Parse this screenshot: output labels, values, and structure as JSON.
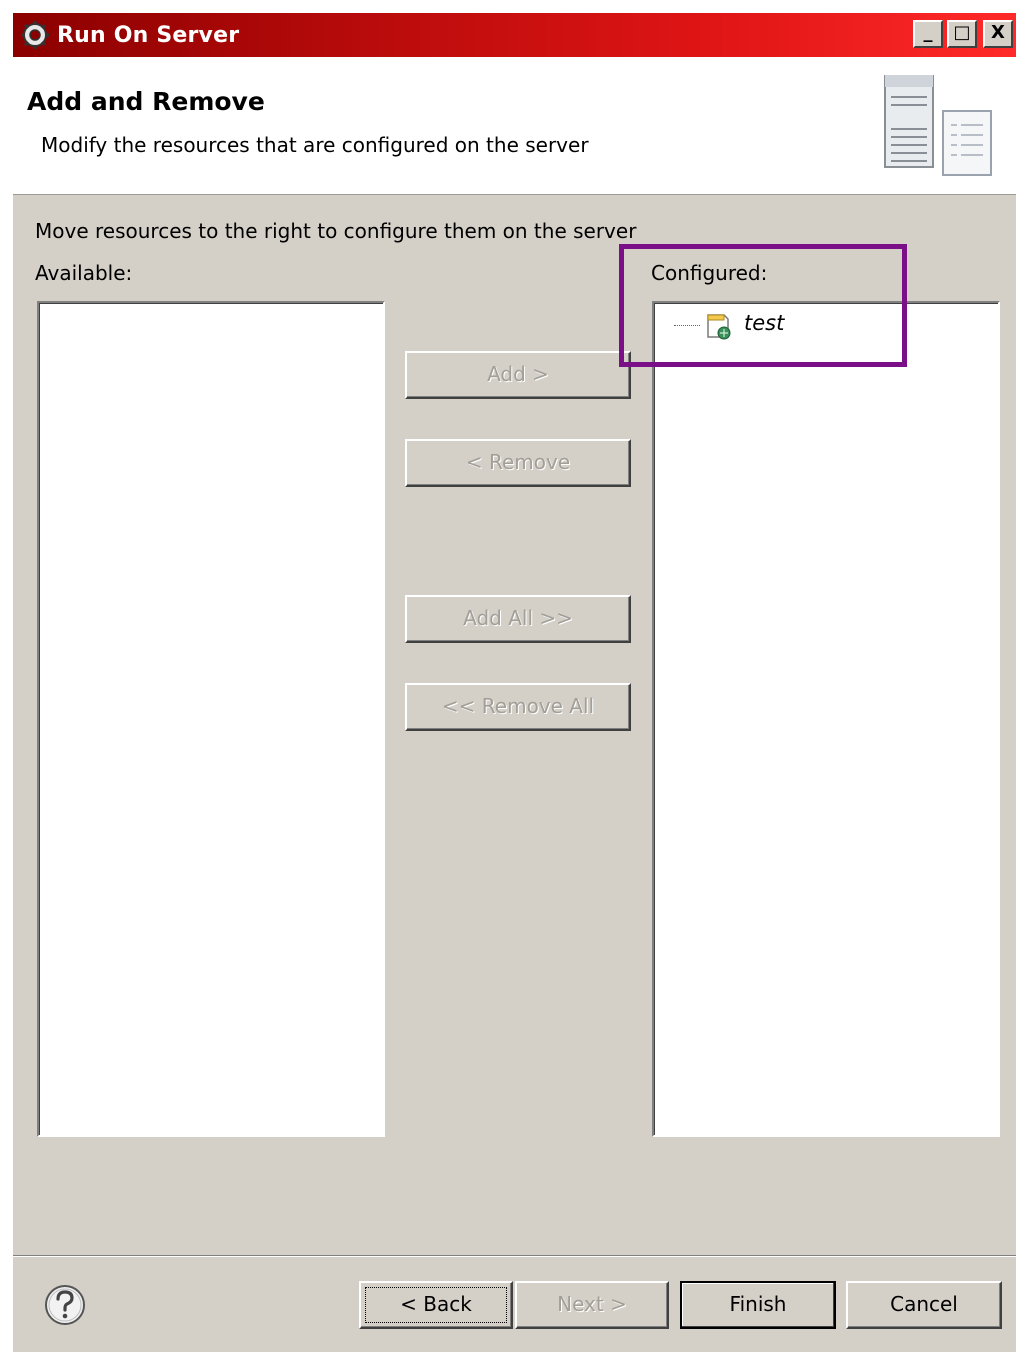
{
  "window": {
    "title": "Run On Server",
    "controls": {
      "minimize": "_",
      "maximize": "□",
      "close": "X"
    }
  },
  "banner": {
    "title": "Add and Remove",
    "description": "Modify the resources that are configured on the server",
    "graphic": "server-banner-icon"
  },
  "content": {
    "instruction": "Move resources to the right to configure them on the server",
    "available_label": "Available:",
    "configured_label": "Configured:",
    "configured_items": [
      {
        "label": "test",
        "icon": "web-project-icon"
      }
    ]
  },
  "transfer_buttons": {
    "add": "Add >",
    "remove": "< Remove",
    "add_all": "Add All >>",
    "remove_all": "<< Remove All"
  },
  "footer": {
    "help_icon": "help-icon",
    "back": "< Back",
    "next": "Next >",
    "finish": "Finish",
    "cancel": "Cancel"
  },
  "colors": {
    "title_bar_start": "#8b0000",
    "title_bar_end": "#ff2a2a",
    "dialog_bg": "#d4d0c8",
    "highlight_box": "#7a0f88"
  }
}
